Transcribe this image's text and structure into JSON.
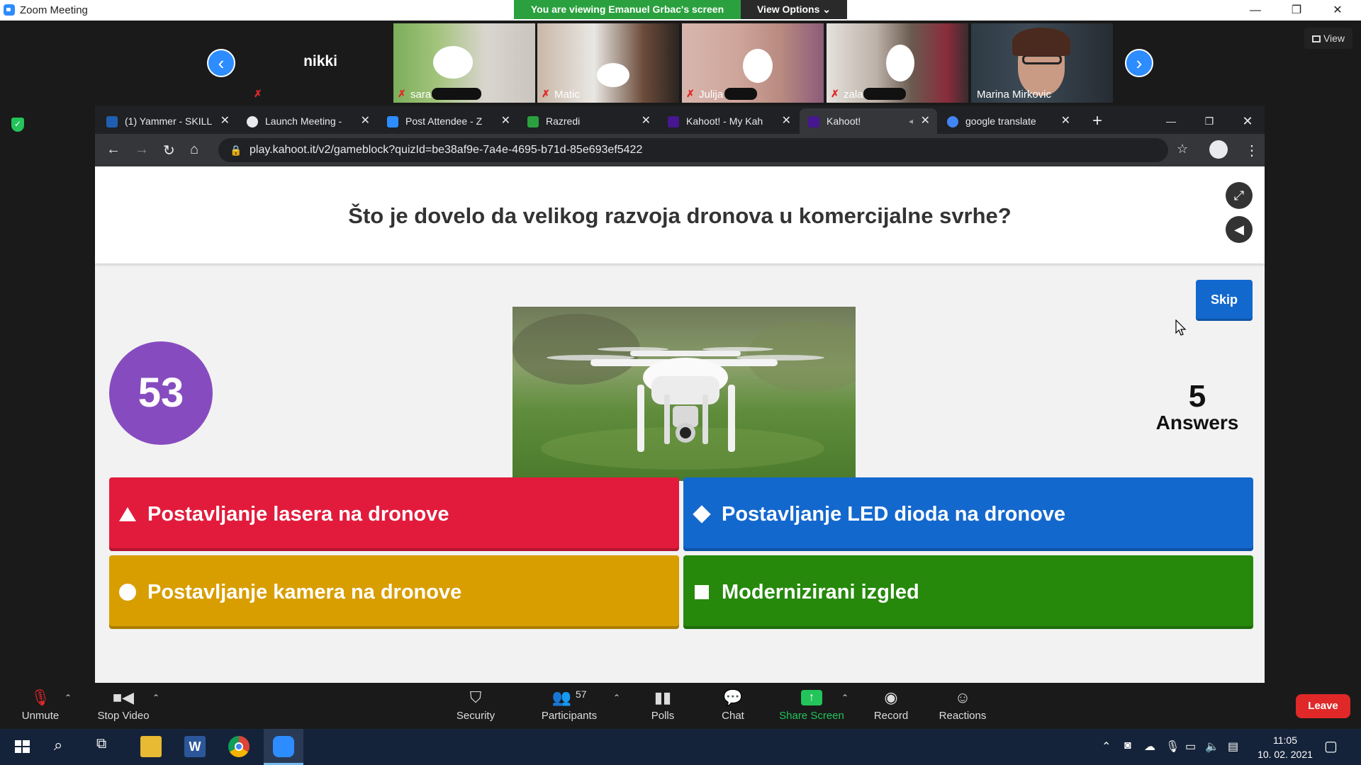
{
  "window": {
    "title": "Zoom Meeting",
    "share_banner": "You are viewing Emanuel Grbac's screen",
    "view_options": "View Options ⌄",
    "minimize": "—",
    "restore": "❐",
    "close": "✕",
    "view_button": "View"
  },
  "gallery": {
    "prev": "‹",
    "next": "›",
    "participants": [
      {
        "name": "nikki"
      },
      {
        "name": "sara"
      },
      {
        "name": "Matic"
      },
      {
        "name": "Julija"
      },
      {
        "name": "zala"
      },
      {
        "name": "Marina Mirkovic"
      }
    ],
    "mute_glyph": "✗"
  },
  "browser": {
    "tabs": [
      {
        "label": "(1) Yammer - SKILL",
        "color": "#1f5fb2"
      },
      {
        "label": "Launch Meeting -",
        "color": "#e8eaed"
      },
      {
        "label": "Post Attendee - Z",
        "color": "#2d8cff"
      },
      {
        "label": "Razredi",
        "color": "#2aa13e"
      },
      {
        "label": "Kahoot! - My Kah",
        "color": "#46178f"
      },
      {
        "label": "Kahoot!",
        "color": "#46178f"
      },
      {
        "label": "google translate",
        "color": "#4285f4"
      }
    ],
    "new_tab": "+",
    "url": "play.kahoot.it/v2/gameblock?quizId=be38af9e-7a4e-4695-b71d-85e693ef5422",
    "minimize": "—",
    "restore": "❐",
    "close": "✕"
  },
  "kahoot": {
    "question": "Što je dovelo da velikog razvoja dronova u komercijalne svrhe?",
    "timer": "53",
    "skip_label": "Skip",
    "answers_count": "5",
    "answers_label": "Answers",
    "options": [
      {
        "text": "Postavljanje lasera na dronove",
        "color": "#e21b3c",
        "shape": "triangle"
      },
      {
        "text": "Postavljanje LED dioda na dronove",
        "color": "#1368ce",
        "shape": "diamond"
      },
      {
        "text": "Postavljanje kamera na dronove",
        "color": "#d89e00",
        "shape": "circle"
      },
      {
        "text": "Modernizirani izgled",
        "color": "#26890c",
        "shape": "square"
      }
    ]
  },
  "toolbar": {
    "unmute": "Unmute",
    "stop_video": "Stop Video",
    "security": "Security",
    "participants": "Participants",
    "participants_count": "57",
    "polls": "Polls",
    "chat": "Chat",
    "share_screen": "Share Screen",
    "record": "Record",
    "reactions": "Reactions",
    "leave": "Leave",
    "caret": "⌃"
  },
  "taskbar": {
    "time": "11:05",
    "date": "10. 02. 2021"
  }
}
